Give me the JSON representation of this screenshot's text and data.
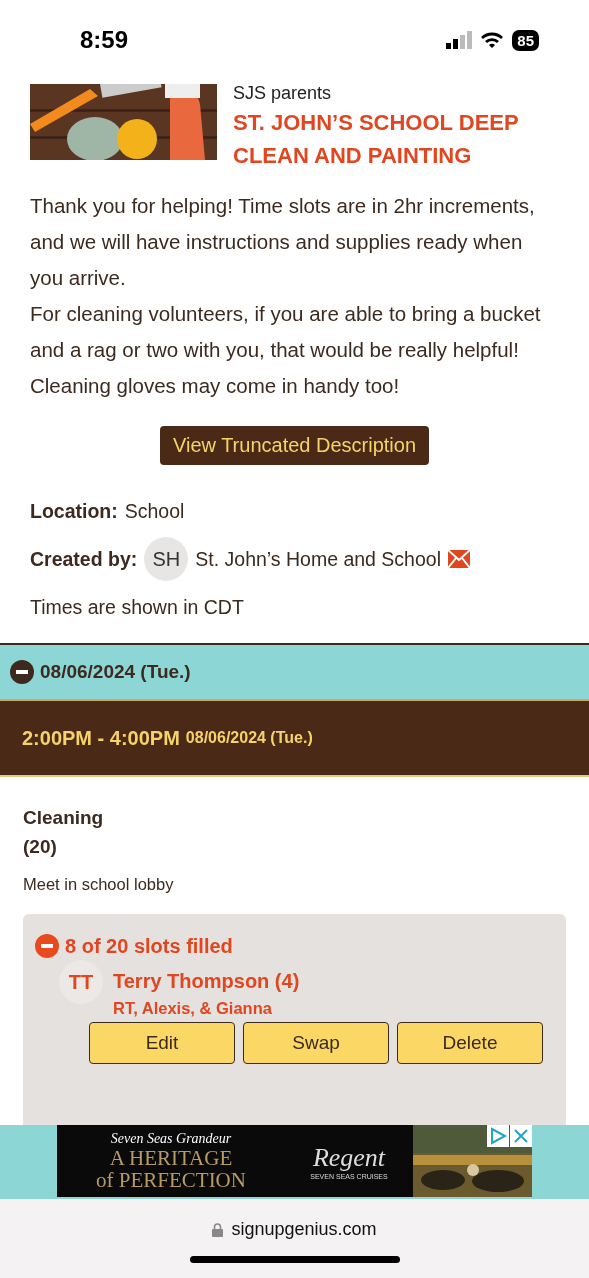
{
  "status_bar": {
    "time": "8:59",
    "battery": "85"
  },
  "header": {
    "group": "SJS parents",
    "title": "ST. JOHN’S SCHOOL DEEP CLEAN AND PAINTING"
  },
  "description": [
    "Thank you for helping! Time slots are in 2hr increments, and we will have instructions and supplies ready when you arrive.",
    "For cleaning volunteers, if you are able to bring a bucket and a rag or two with you, that would be really helpful! Cleaning gloves may come in handy too!"
  ],
  "truncate_button": "View Truncated Description",
  "location": {
    "label": "Location:",
    "value": "School"
  },
  "created_by": {
    "label": "Created by:",
    "initials": "SH",
    "name": "St. John’s Home and School"
  },
  "timezone_note": "Times are shown in CDT",
  "date_group": {
    "date": "08/06/2024 (Tue.)",
    "expanded": true
  },
  "time_slot": {
    "time": "2:00PM - 4:00PM",
    "date": "08/06/2024 (Tue.)"
  },
  "task": {
    "name": "Cleaning",
    "count": "(20)",
    "note": "Meet in school lobby"
  },
  "slots": {
    "summary": "8 of 20 slots filled",
    "expanded": true,
    "signups": [
      {
        "initials": "TT",
        "name": "Terry Thompson (4)",
        "comment": "RT, Alexis, & Gianna",
        "actions": [
          "Edit",
          "Swap",
          "Delete"
        ]
      }
    ]
  },
  "ad": {
    "tagline": "Seven Seas Grandeur",
    "headline_1": "A HERITAGE",
    "headline_2": "of PERFECTION",
    "brand": "Regent",
    "brand_sub": "SEVEN SEAS CRUISES"
  },
  "browser": {
    "url": "signupgenius.com"
  }
}
